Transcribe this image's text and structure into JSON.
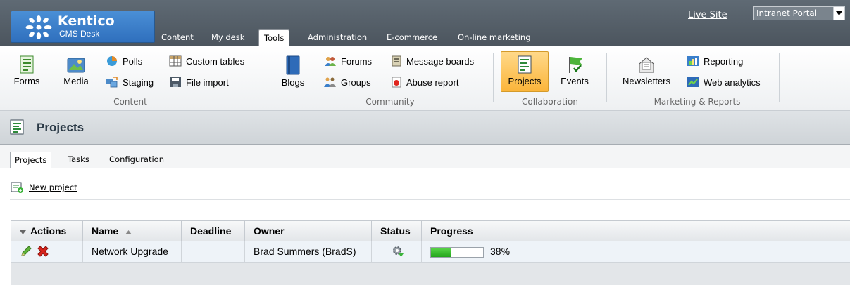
{
  "header": {
    "logo_title": "Kentico",
    "logo_subtitle": "CMS Desk",
    "live_site": "Live Site",
    "portal": "Intranet Portal",
    "tabs": [
      {
        "label": "Content",
        "active": false
      },
      {
        "label": "My desk",
        "active": false
      },
      {
        "label": "Tools",
        "active": true
      },
      {
        "label": "Administration",
        "active": false
      },
      {
        "label": "E-commerce",
        "active": false
      },
      {
        "label": "On-line marketing",
        "active": false
      }
    ]
  },
  "ribbon": {
    "content": {
      "label": "Content",
      "forms": "Forms",
      "media": "Media",
      "polls": "Polls",
      "staging": "Staging",
      "custom_tables": "Custom tables",
      "file_import": "File import"
    },
    "community": {
      "label": "Community",
      "blogs": "Blogs",
      "forums": "Forums",
      "groups": "Groups",
      "message_boards": "Message boards",
      "abuse_report": "Abuse report"
    },
    "collaboration": {
      "label": "Collaboration",
      "projects": "Projects",
      "events": "Events"
    },
    "marketing": {
      "label": "Marketing & Reports",
      "newsletters": "Newsletters",
      "reporting": "Reporting",
      "web_analytics": "Web analytics"
    }
  },
  "page": {
    "title": "Projects",
    "subtabs": [
      "Projects",
      "Tasks",
      "Configuration"
    ],
    "new_project": "New project"
  },
  "grid": {
    "columns": {
      "actions": "Actions",
      "name": "Name",
      "deadline": "Deadline",
      "owner": "Owner",
      "status": "Status",
      "progress": "Progress"
    },
    "rows": [
      {
        "name": "Network Upgrade",
        "deadline": "",
        "owner": "Brad Summers (BradS)",
        "status_icon": "gear-arrow-icon",
        "progress": 0.38,
        "progress_label": "38%"
      }
    ]
  },
  "colors": {
    "topbar": "#55606a",
    "logo": "#3a7fcb",
    "progress_fill": "#2fb326",
    "active_ribbon": "#fbc45a"
  }
}
